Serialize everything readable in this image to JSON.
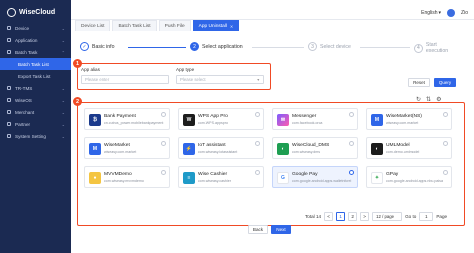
{
  "header": {
    "logo_text": "WiseCloud",
    "language": "English",
    "username": "Zio"
  },
  "sidebar": {
    "items": [
      {
        "label": "Device",
        "icon": "device-icon"
      },
      {
        "label": "Application",
        "icon": "application-icon"
      },
      {
        "label": "Batch Task",
        "icon": "batch-task-icon"
      },
      {
        "label": "TR-TMS",
        "icon": "tms-icon"
      },
      {
        "label": "WiseOS",
        "icon": "wiseos-icon"
      },
      {
        "label": "Merchant",
        "icon": "merchant-icon"
      },
      {
        "label": "Partner",
        "icon": "partner-icon"
      },
      {
        "label": "System Setting",
        "icon": "settings-icon"
      }
    ],
    "sub_items": [
      {
        "label": "Batch Task List",
        "active": true
      },
      {
        "label": "Export Task List",
        "active": false
      }
    ]
  },
  "tabs": [
    {
      "label": "Device List",
      "active": false
    },
    {
      "label": "Batch Task List",
      "active": false
    },
    {
      "label": "Push File",
      "active": false
    },
    {
      "label": "App Uninstall",
      "active": true
    }
  ],
  "steps": [
    {
      "num": "✓",
      "label": "Basic info",
      "state": "done"
    },
    {
      "num": "2",
      "label": "Select application",
      "state": "current"
    },
    {
      "num": "3",
      "label": "Select device",
      "state": "pending"
    },
    {
      "num": "4",
      "label": "Start execution",
      "state": "pending"
    }
  ],
  "filters": {
    "badge": "1",
    "app_alias_label": "App alias",
    "app_alias_placeholder": "Please enter",
    "app_type_label": "App type",
    "app_type_placeholder": "Please select",
    "reset_label": "Reset",
    "query_label": "Query"
  },
  "grid": {
    "badge": "2",
    "apps": [
      {
        "name": "Bank Payment",
        "pkg": "cn.cutrus_power.mobilebankpayment",
        "color": "#1b3a8c",
        "selected": false
      },
      {
        "name": "WPS App Pro",
        "pkg": "com.WPS.appspro",
        "color": "#1c1c1c",
        "selected": false
      },
      {
        "name": "Messenger",
        "pkg": "com.facebook.orca",
        "color": "#ffffff",
        "selected": false
      },
      {
        "name": "WiseMarket(NS)",
        "pkg": "wiseasy.com.market",
        "color": "#2f66e8",
        "selected": false
      },
      {
        "name": "WiseMarket",
        "pkg": "wiseasy.com.market",
        "color": "#2f66e8",
        "selected": false
      },
      {
        "name": "IoT assistant",
        "pkg": "com.wiseasy.iotassistant",
        "color": "#2f66e8",
        "selected": false
      },
      {
        "name": "WiseCloud_DMS",
        "pkg": "com.wiseasy.dms",
        "color": "#1e9e52",
        "selected": false
      },
      {
        "name": "UMLModel",
        "pkg": "com.demo.umlmodel",
        "color": "#1c1c1c",
        "selected": false
      },
      {
        "name": "MVVMDemo",
        "pkg": "com.wiseasy.mvvmdemo",
        "color": "#f4c542",
        "selected": false
      },
      {
        "name": "Wise Cashier",
        "pkg": "com.wiseasy.cashier",
        "color": "#1e9ac8",
        "selected": false
      },
      {
        "name": "Google Pay",
        "pkg": "com.google.android.apps.walletnfcrel",
        "color": "#ffffff",
        "selected": true
      },
      {
        "name": "GPay",
        "pkg": "com.google.android.apps.nbu.paisa",
        "color": "#ffffff",
        "selected": false
      }
    ]
  },
  "pagination": {
    "total": "Total 14",
    "prev": "<",
    "pages": [
      "1",
      "2"
    ],
    "current": "1",
    "next": ">",
    "page_size": "12 / page",
    "goto_label": "Go to",
    "goto_value": "1",
    "page_suffix": "Page"
  },
  "footer": {
    "back_label": "Back",
    "next_label": "Next"
  }
}
